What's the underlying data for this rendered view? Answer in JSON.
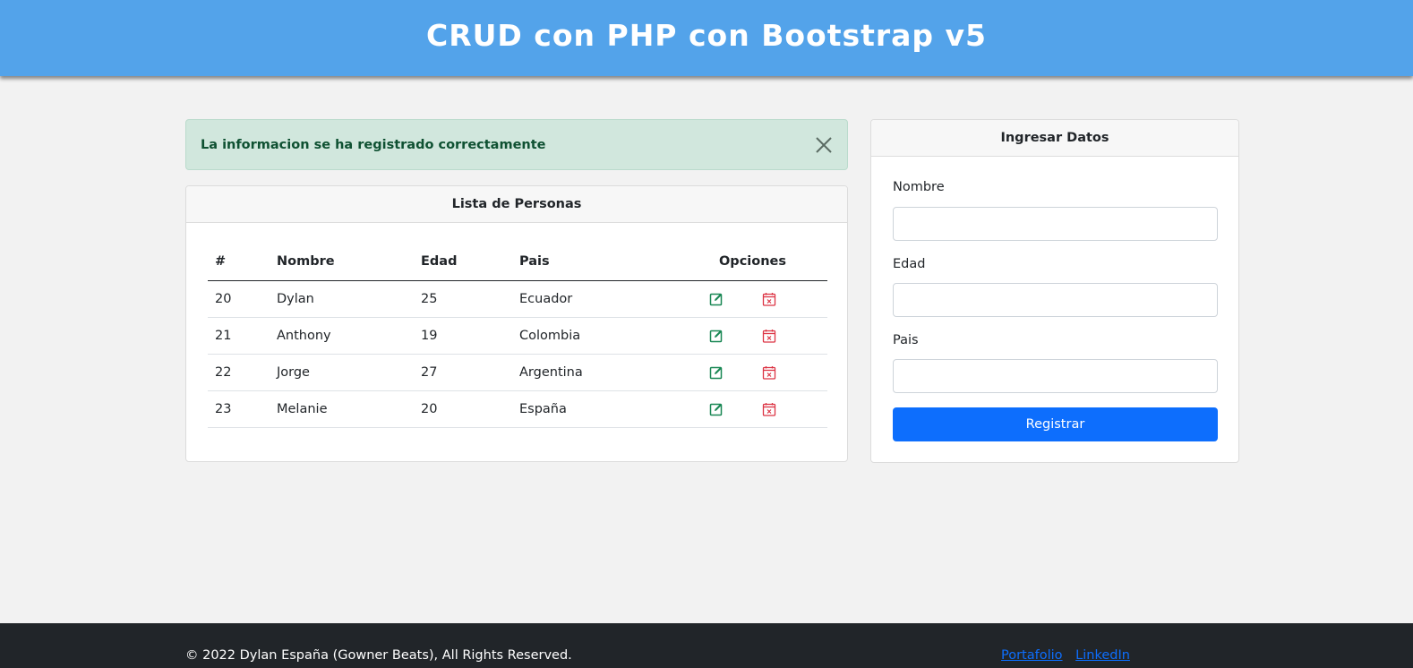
{
  "header": {
    "title": "CRUD con PHP con Bootstrap v5"
  },
  "alert": {
    "message": "La informacion se ha registrado correctamente",
    "close_icon": "close-icon"
  },
  "list": {
    "title": "Lista de Personas",
    "columns": [
      "#",
      "Nombre",
      "Edad",
      "Pais",
      "Opciones"
    ],
    "rows": [
      {
        "id": "20",
        "nombre": "Dylan",
        "edad": "25",
        "pais": "Ecuador"
      },
      {
        "id": "21",
        "nombre": "Anthony",
        "edad": "19",
        "pais": "Colombia"
      },
      {
        "id": "22",
        "nombre": "Jorge",
        "edad": "27",
        "pais": "Argentina"
      },
      {
        "id": "23",
        "nombre": "Melanie",
        "edad": "20",
        "pais": "España"
      }
    ],
    "edit_icon": "edit-icon",
    "delete_icon": "delete-calendar-icon",
    "edit_color": "#198754",
    "delete_color": "#dc3545"
  },
  "form": {
    "title": "Ingresar Datos",
    "nombre_label": "Nombre",
    "nombre_value": "",
    "edad_label": "Edad",
    "edad_value": "",
    "pais_label": "Pais",
    "pais_value": "",
    "submit_label": "Registrar"
  },
  "footer": {
    "copyright": "© 2022 Dylan España (Gowner Beats), All Rights Reserved.",
    "links": [
      "Portafolio",
      "LinkedIn"
    ]
  },
  "colors": {
    "header_bg": "#53a3ea",
    "alert_bg": "#d1e7dd",
    "alert_text": "#0f5132",
    "primary": "#0d6efd",
    "footer_bg": "#212529"
  }
}
